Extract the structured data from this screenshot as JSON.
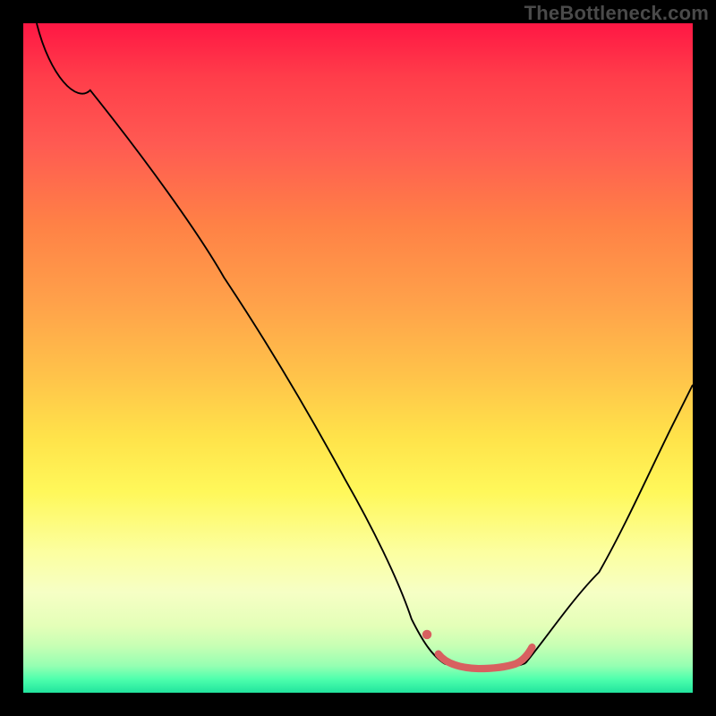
{
  "watermark": "TheBottleneck.com",
  "chart_data": {
    "type": "line",
    "title": "",
    "xlabel": "",
    "ylabel": "",
    "xlim": [
      0,
      100
    ],
    "ylim": [
      0,
      100
    ],
    "series": [
      {
        "name": "curve-left",
        "color": "#000000",
        "stroke_width": 1.6,
        "x": [
          2,
          10,
          20,
          30,
          40,
          48,
          54,
          58,
          60,
          62,
          63
        ],
        "y": [
          100,
          90,
          76,
          62,
          46,
          32,
          20,
          11,
          7,
          5,
          4.3
        ]
      },
      {
        "name": "curve-right",
        "color": "#000000",
        "stroke_width": 1.6,
        "x": [
          75,
          80,
          86,
          92,
          97,
          100
        ],
        "y": [
          4.4,
          9,
          18,
          30,
          40,
          46
        ]
      },
      {
        "name": "bottom-bar",
        "color": "#d86060",
        "stroke_width": 8,
        "x": [
          61,
          63,
          66,
          70,
          73,
          75,
          76
        ],
        "y": [
          6.5,
          4.3,
          3.8,
          3.8,
          4.0,
          5.0,
          7.0
        ]
      },
      {
        "name": "dot",
        "color": "#d86060",
        "type": "point",
        "x": [
          60
        ],
        "y": [
          9
        ]
      }
    ]
  },
  "colors": {
    "frame_bg": "#000000",
    "curve": "#000000",
    "accent": "#d86060"
  }
}
